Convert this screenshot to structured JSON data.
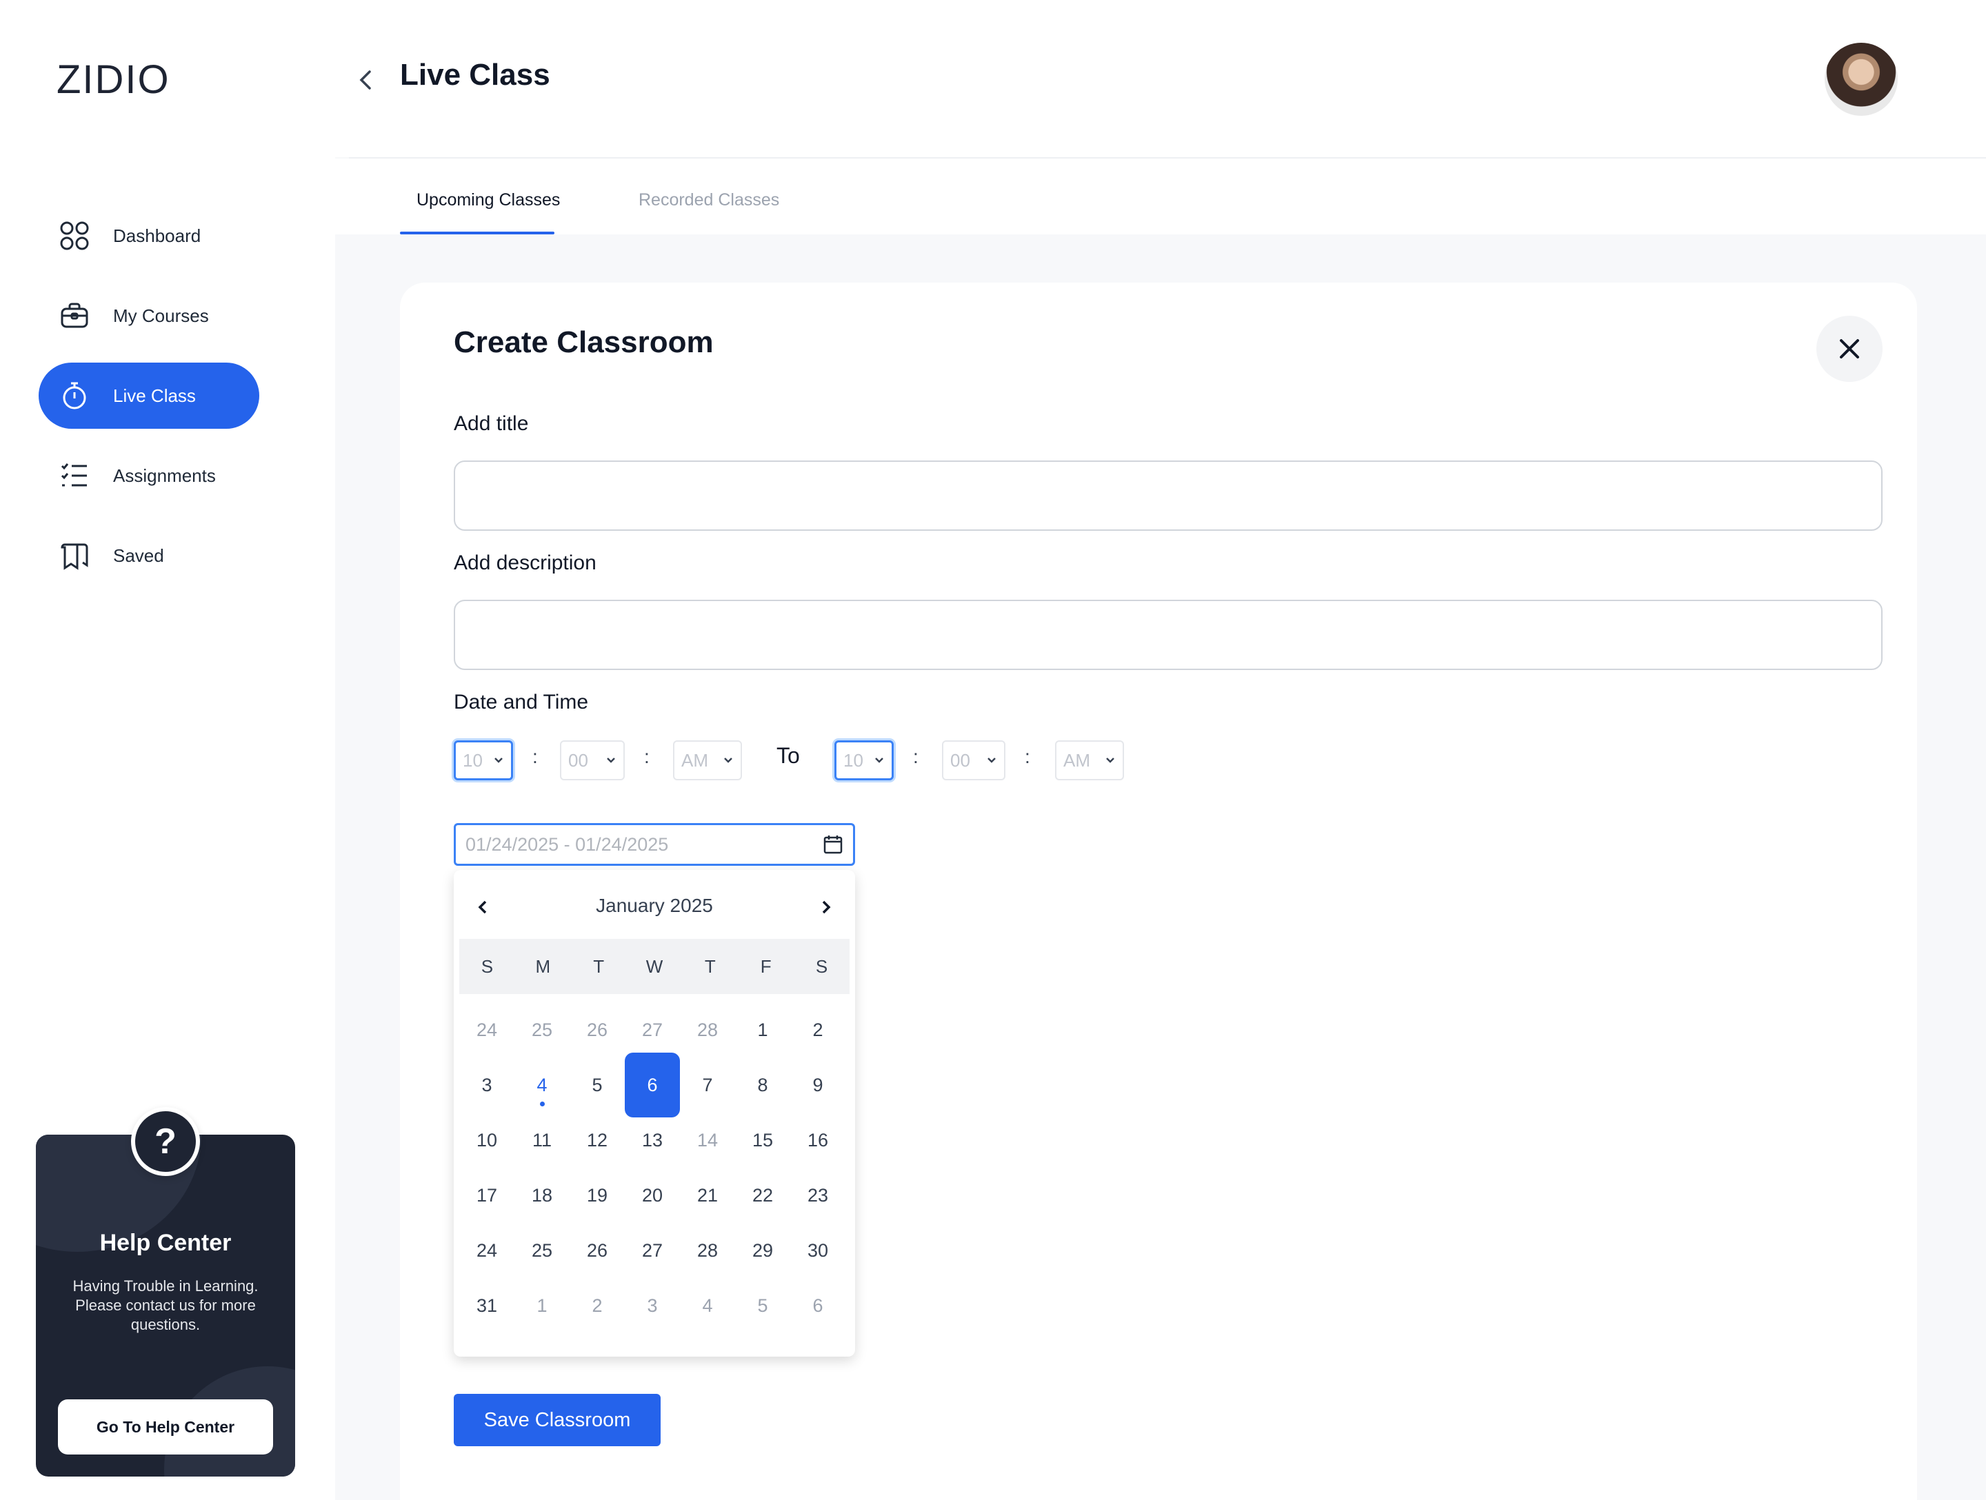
{
  "app": {
    "logo": "ZIDIO"
  },
  "sidebar": {
    "items": [
      {
        "label": "Dashboard",
        "icon": "grid-icon"
      },
      {
        "label": "My Courses",
        "icon": "briefcase-icon"
      },
      {
        "label": "Live Class",
        "icon": "stopwatch-icon",
        "active": true
      },
      {
        "label": "Assignments",
        "icon": "checklist-icon"
      },
      {
        "label": "Saved",
        "icon": "bookmark-icon"
      }
    ]
  },
  "help": {
    "badge": "?",
    "title": "Help Center",
    "text": "Having Trouble in Learning. Please contact us for more questions.",
    "button": "Go To Help Center"
  },
  "header": {
    "title": "Live Class"
  },
  "tabs": [
    {
      "label": "Upcoming Classes",
      "active": true
    },
    {
      "label": "Recorded Classes",
      "active": false
    }
  ],
  "form": {
    "title": "Create Classroom",
    "title_label": "Add title",
    "title_value": "",
    "description_label": "Add description",
    "description_value": "",
    "datetime_label": "Date and Time",
    "start": {
      "hour": "10",
      "minute": "00",
      "period": "AM"
    },
    "to_label": "To",
    "end": {
      "hour": "10",
      "minute": "00",
      "period": "AM"
    },
    "time_sep": ":",
    "date_range_placeholder": "01/24/2025 - 01/24/2025",
    "save_label": "Save Classroom"
  },
  "calendar": {
    "month_label": "January 2025",
    "weekdays": [
      "S",
      "M",
      "T",
      "W",
      "T",
      "F",
      "S"
    ],
    "days": [
      {
        "d": "24",
        "m": true
      },
      {
        "d": "25",
        "m": true
      },
      {
        "d": "26",
        "m": true
      },
      {
        "d": "27",
        "m": true
      },
      {
        "d": "28",
        "m": true
      },
      {
        "d": "1"
      },
      {
        "d": "2"
      },
      {
        "d": "3"
      },
      {
        "d": "4",
        "today": true
      },
      {
        "d": "5"
      },
      {
        "d": "6",
        "selected": true
      },
      {
        "d": "7"
      },
      {
        "d": "8"
      },
      {
        "d": "9"
      },
      {
        "d": "10"
      },
      {
        "d": "11"
      },
      {
        "d": "12"
      },
      {
        "d": "13"
      },
      {
        "d": "14",
        "m": true
      },
      {
        "d": "15"
      },
      {
        "d": "16"
      },
      {
        "d": "17"
      },
      {
        "d": "18"
      },
      {
        "d": "19"
      },
      {
        "d": "20"
      },
      {
        "d": "21"
      },
      {
        "d": "22"
      },
      {
        "d": "23"
      },
      {
        "d": "24"
      },
      {
        "d": "25"
      },
      {
        "d": "26"
      },
      {
        "d": "27"
      },
      {
        "d": "28"
      },
      {
        "d": "29"
      },
      {
        "d": "30"
      },
      {
        "d": "31"
      },
      {
        "d": "1",
        "m": true
      },
      {
        "d": "2",
        "m": true
      },
      {
        "d": "3",
        "m": true
      },
      {
        "d": "4",
        "m": true
      },
      {
        "d": "5",
        "m": true
      },
      {
        "d": "6",
        "m": true
      }
    ]
  },
  "colors": {
    "accent": "#2563eb",
    "dark": "#1e2433"
  }
}
